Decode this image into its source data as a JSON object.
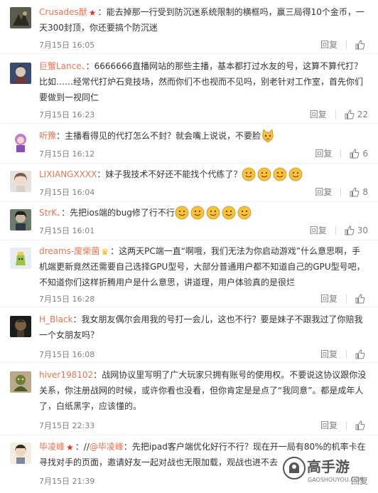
{
  "comments": [
    {
      "username": "Crusades猷",
      "badge": "red-star",
      "separator": "：",
      "text": "能去掉那一行受到防沉迷系统限制的横框吗，赢三局得10个金币，一天300封顶，你还要搞个防沉迷",
      "date": "7月15日 16:05",
      "reply_label": "回复",
      "likes": ""
    },
    {
      "username": "巨蟹Lance、",
      "badge": "",
      "separator": "：",
      "text": "6666666直播网站的那些主播，基本都打过水友的号，这算不算代打？比如……经常代打炉石竞技场，然而你们不也视而不见吗，别老针对工作室，首先你们要做到一视同仁",
      "date": "7月15日 16:23",
      "reply_label": "回复",
      "likes": "22"
    },
    {
      "username": "听豫",
      "badge": "",
      "separator": "：",
      "text": "主播看得见的代打怎么不封？就会嘴上说说，不要脸",
      "date": "7月15日 16:12",
      "reply_label": "回复",
      "likes": "6"
    },
    {
      "username": "LIXIANGXXXX",
      "badge": "",
      "separator": "：",
      "text": "妹子我技术不好还不能找个代练了？",
      "date": "7月15日 16:04",
      "reply_label": "回复",
      "likes": "8"
    },
    {
      "username": "StrK、",
      "badge": "",
      "separator": "：",
      "text": "先把ios端的bug修了行不行",
      "date": "7月15日 16:01",
      "reply_label": "回复",
      "likes": "30"
    },
    {
      "username": "dreams-废柴菌",
      "badge": "gold",
      "separator": "：",
      "text": "这两天PC端一直“啊哦，我们无法为你启动游戏”什么意思啊，手机端更新竟然还需要自己选择GPU型号，大部分普通用户都不知道自己的GPU型号吧，不知道你们这样折腾用户是什么意思，讲道理，用户体验真的是很烂",
      "date": "7月15日 16:28",
      "reply_label": "回复",
      "likes": ""
    },
    {
      "username": "H_Black",
      "badge": "",
      "separator": "：",
      "text": "我女朋友偶尔会用我的号打一会儿，这也不行？要是妹子不跟我过了你赔我一个女朋友吗？",
      "date": "7月15日 16:08",
      "reply_label": "回复",
      "likes": ""
    },
    {
      "username": "hiver198102",
      "badge": "",
      "separator": "：",
      "text": "战网协议里写明了广大玩家只拥有账号的使用权。不要说这协议跟你没关系，你注册战网的时候，或许你看也没看，但你肯定是是点了“我同意”。都是成年人了，白纸黑字，应该懂的。",
      "date": "7月15日 22:33",
      "reply_label": "回复",
      "likes": ""
    },
    {
      "username": "毕凌峰",
      "badge": "red-star",
      "separator": "：",
      "mention_prefix": "//",
      "mention": "@毕凌峰",
      "text": "：先把ipad客户端优化好行不行？现在开一局有80%的机率卡在寻找对手的页面，邀请好友一起对战也无限加载，观战也进不去",
      "date": "7月15日 21:39",
      "reply_label": "回复",
      "likes": ""
    }
  ],
  "watermark": {
    "brand": "高手游",
    "domain": "GAOSHOUYOU.COM"
  },
  "colors": {
    "username": "#eb7350",
    "text": "#333333",
    "meta": "#808080",
    "divider": "#eeeeee",
    "emoji": "#f7c13b"
  }
}
